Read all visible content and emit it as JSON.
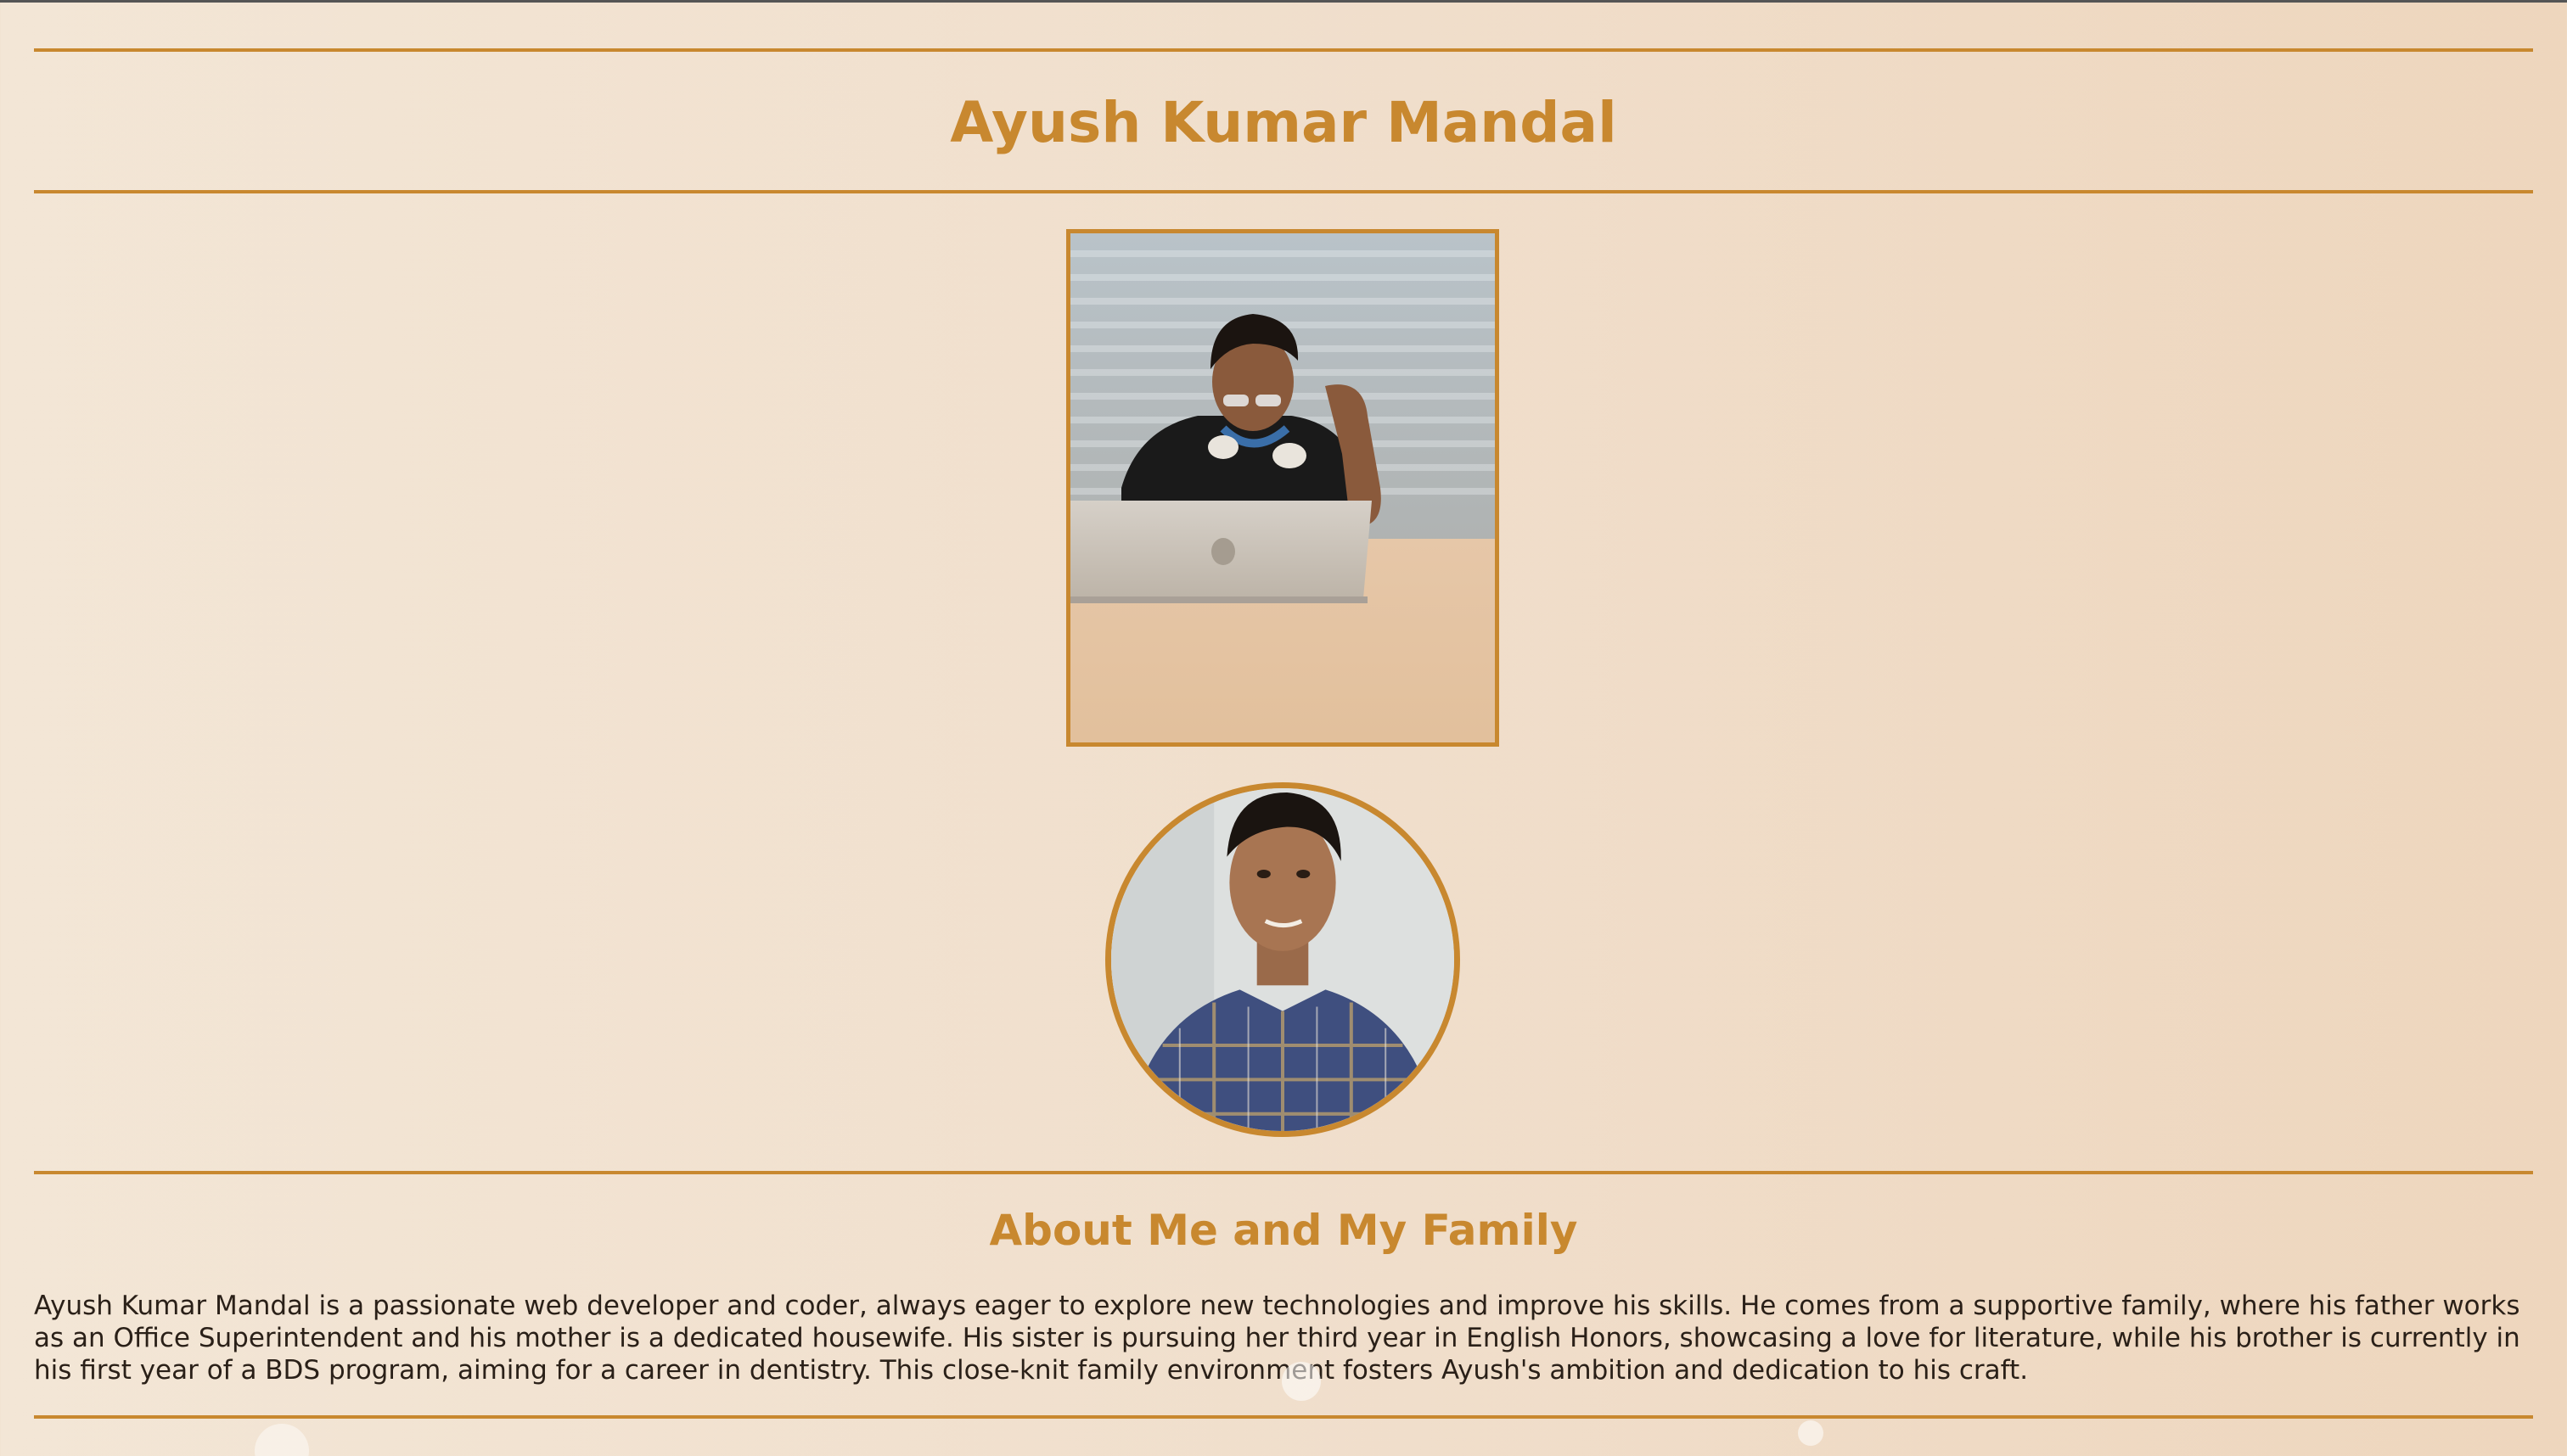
{
  "header": {
    "title": "Ayush Kumar Mandal"
  },
  "photos": {
    "laptop_photo_label": "Ayush at laptop",
    "profile_photo_label": "Ayush profile portrait"
  },
  "about": {
    "heading": "About Me and My Family",
    "paragraph": "Ayush Kumar Mandal is a passionate web developer and coder, always eager to explore new technologies and improve his skills. He comes from a supportive family, where his father works as an Office Superintendent and his mother is a dedicated housewife. His sister is pursuing her third year in English Honors, showcasing a love for literature, while his brother is currently in his first year of a BDS program, aiming for a career in dentistry. This close-knit family environment fosters Ayush's ambition and dedication to his craft."
  },
  "colors": {
    "accent": "#c8882f",
    "background": "#f0decb",
    "text": "#2a2018"
  }
}
